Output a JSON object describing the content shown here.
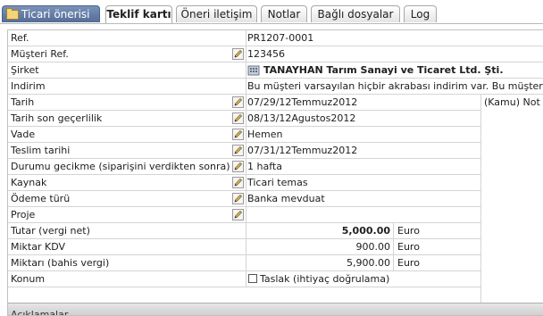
{
  "tabs": [
    {
      "label": "Ticari önerisi",
      "kind": "main"
    },
    {
      "label": "Teklif kartı",
      "kind": "active"
    },
    {
      "label": "Öneri iletişim"
    },
    {
      "label": "Notlar"
    },
    {
      "label": "Bağlı dosyalar"
    },
    {
      "label": "Log"
    }
  ],
  "fields": {
    "ref": {
      "label": "Ref.",
      "value": "PR1207-0001"
    },
    "customer_ref": {
      "label": "Müşteri Ref.",
      "value": "123456"
    },
    "company": {
      "label": "Şirket",
      "value": "TANAYHAN Tarım Sanayi ve Ticaret Ltd. Şti."
    },
    "discount": {
      "label": "Indirim",
      "value": "Bu müşteri varsayılan hiçbir akrabası indirim var. Bu müşteri"
    },
    "date": {
      "label": "Tarih",
      "value": "07/29/12Temmuz2012",
      "side_note": "(Kamu) Not"
    },
    "validity": {
      "label": "Tarih son geçerlilik",
      "value": "08/13/12Agustos2012"
    },
    "due": {
      "label": "Vade",
      "value": "Hemen"
    },
    "delivery_date": {
      "label": "Teslim tarihi",
      "value": "07/31/12Temmuz2012"
    },
    "delay": {
      "label": "Durumu gecikme (siparişini verdikten sonra)",
      "value": "1 hafta"
    },
    "source": {
      "label": "Kaynak",
      "value": "Ticari temas"
    },
    "payment": {
      "label": "Ödeme türü",
      "value": "Banka mevduat"
    },
    "project": {
      "label": "Proje",
      "value": ""
    },
    "amount_net": {
      "label": "Tutar (vergi net)",
      "value": "5,000.00",
      "unit": "Euro"
    },
    "vat": {
      "label": "Miktar KDV",
      "value": "900.00",
      "unit": "Euro"
    },
    "amount_incl": {
      "label": "Miktarı (bahis vergi)",
      "value": "5,900.00",
      "unit": "Euro"
    },
    "status": {
      "label": "Konum",
      "checkbox_label": "Taslak (ihtiyaç doğrulama)",
      "checked": false
    }
  },
  "section": {
    "title": "Açıklamalar"
  },
  "icons": {
    "edit": "pencil-edit-icon",
    "company": "building-icon",
    "tab_main": "folder-icon"
  },
  "colors": {
    "tab_main_bg": "#5f78a3",
    "border": "#d4d4d4",
    "bottom_bar": "#d0d0d0"
  }
}
